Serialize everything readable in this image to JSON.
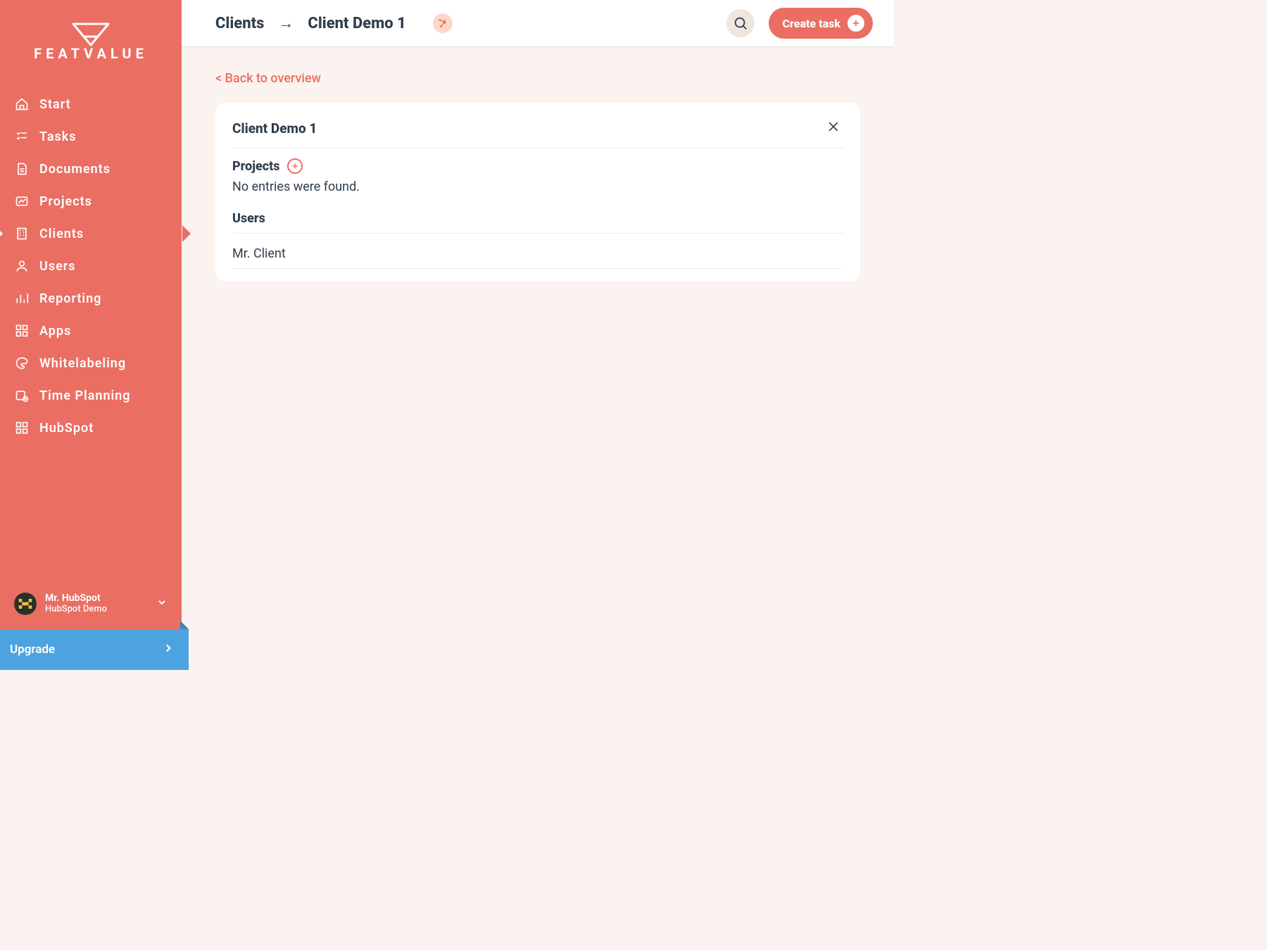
{
  "brand": "FEATVALUE",
  "sidebar": {
    "items": [
      {
        "label": "Start"
      },
      {
        "label": "Tasks"
      },
      {
        "label": "Documents"
      },
      {
        "label": "Projects"
      },
      {
        "label": "Clients"
      },
      {
        "label": "Users"
      },
      {
        "label": "Reporting"
      },
      {
        "label": "Apps"
      },
      {
        "label": "Whitelabeling"
      },
      {
        "label": "Time Planning"
      },
      {
        "label": "HubSpot"
      }
    ],
    "user": {
      "name": "Mr. HubSpot",
      "subtitle": "HubSpot Demo"
    },
    "upgrade_label": "Upgrade"
  },
  "header": {
    "breadcrumb_root": "Clients",
    "breadcrumb_current": "Client Demo 1",
    "create_label": "Create task"
  },
  "main": {
    "back_label": "< Back to overview",
    "card": {
      "title": "Client Demo 1",
      "projects_label": "Projects",
      "projects_empty": "No entries were found.",
      "users_label": "Users",
      "users": [
        {
          "name": "Mr. Client"
        }
      ]
    }
  }
}
